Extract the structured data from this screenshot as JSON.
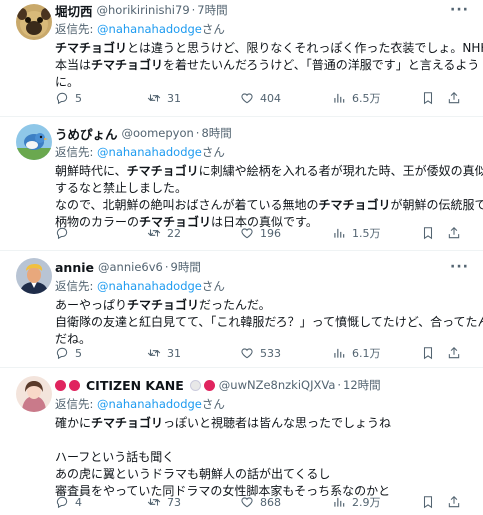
{
  "tweets": [
    {
      "name": "堀切西",
      "handle": "@horikirinishi79",
      "time": "7時間",
      "reply_prefix": "返信先: ",
      "reply_to": "@nahanahadodge",
      "reply_suffix": "さん",
      "lines": [
        [
          {
            "t": "チマチョゴリ",
            "b": true
          },
          {
            "t": "とは違うと思うけど、限りなくそれっぽく作った衣装でしょ。NHKは"
          }
        ],
        [
          {
            "t": "本当は"
          },
          {
            "t": "チマチョゴリ",
            "b": true
          },
          {
            "t": "を着せたいんだろうけど、「普通の洋服です」と言えるよう"
          }
        ],
        [
          {
            "t": "に。"
          }
        ]
      ],
      "replies": "5",
      "retweets": "31",
      "likes": "404",
      "views": "6.5万"
    },
    {
      "name": "うめぴょん",
      "handle": "@oomepyon",
      "time": "8時間",
      "reply_prefix": "返信先: ",
      "reply_to": "@nahanahadodge",
      "reply_suffix": "さん",
      "lines": [
        [
          {
            "t": "朝鮮時代に、"
          },
          {
            "t": "チマチョゴリ",
            "b": true
          },
          {
            "t": "に刺繍や絵柄を入れる者が現れた時、王が倭奴の真似を"
          }
        ],
        [
          {
            "t": "するなと禁止しました。"
          }
        ],
        [
          {
            "t": "なので、北朝鮮の絶叫おばさんが着ている無地の"
          },
          {
            "t": "チマチョゴリ",
            "b": true
          },
          {
            "t": "が朝鮮の伝統服で、"
          }
        ],
        [
          {
            "t": "柄物のカラーの"
          },
          {
            "t": "チマチョゴリ",
            "b": true
          },
          {
            "t": "は日本の真似です。"
          }
        ]
      ],
      "replies": "",
      "retweets": "22",
      "likes": "196",
      "views": "1.5万"
    },
    {
      "name": "annie",
      "handle": "@annie6v6",
      "time": "9時間",
      "reply_prefix": "返信先: ",
      "reply_to": "@nahanahadodge",
      "reply_suffix": "さん",
      "lines": [
        [
          {
            "t": "あーやっぱり"
          },
          {
            "t": "チマチョゴリ",
            "b": true
          },
          {
            "t": "だったんだ。"
          }
        ],
        [
          {
            "t": "自衛隊の友達と紅白見てて、「これ韓服だろ？」って憤慨してたけど、合ってたん"
          }
        ],
        [
          {
            "t": "だね。"
          }
        ]
      ],
      "replies": "5",
      "retweets": "31",
      "likes": "533",
      "views": "6.1万"
    },
    {
      "name": "CITIZEN KANE",
      "handle": "@uwNZe8nzkiQJXVa",
      "time": "12時間",
      "reply_prefix": "返信先: ",
      "reply_to": "@nahanahadodge",
      "reply_suffix": "さん",
      "lines": [
        [
          {
            "t": "確かに"
          },
          {
            "t": "チマチョゴリ",
            "b": true
          },
          {
            "t": "っぽいと視聴者は皆んな思ったでしょうね"
          }
        ],
        [
          {
            "t": ""
          }
        ],
        [
          {
            "t": "ハーフという話も聞く"
          }
        ],
        [
          {
            "t": "あの虎に翼というドラマも朝鮮人の話が出てくるし"
          }
        ],
        [
          {
            "t": "審査員をやっていた同ドラマの女性脚本家もそっち系なのかと"
          }
        ]
      ],
      "replies": "4",
      "retweets": "73",
      "likes": "868",
      "views": "2.9万"
    }
  ],
  "colors": {
    "link": "#1d9bf0",
    "secondary": "#536471",
    "border": "#eff3f4"
  }
}
